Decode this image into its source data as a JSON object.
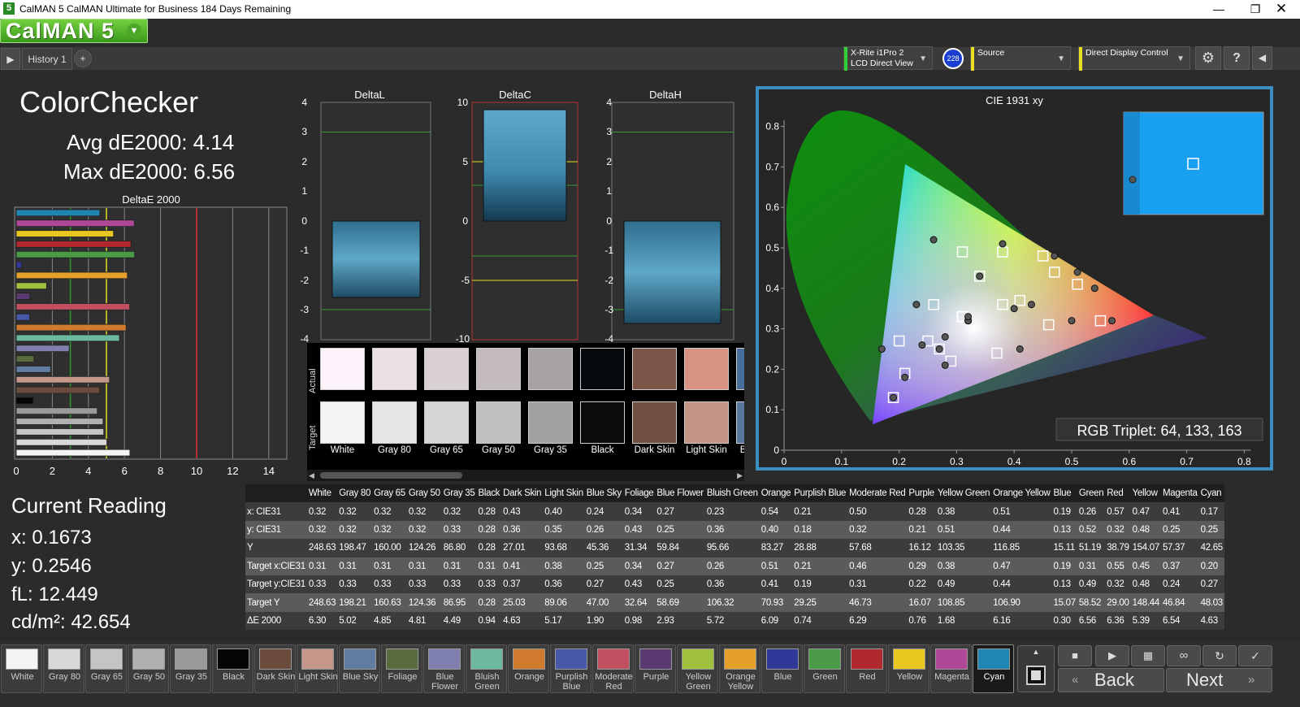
{
  "window": {
    "title": "CalMAN 5 CalMAN Ultimate for Business 184 Days Remaining",
    "app_icon": "5"
  },
  "logo": {
    "text": "CalMAN 5"
  },
  "tabs": {
    "history": "History 1"
  },
  "devices": {
    "meter_line1": "X-Rite i1Pro 2",
    "meter_line2": "LCD Direct View",
    "meter_badge": "228",
    "source": "Source",
    "display": "Direct Display Control"
  },
  "page": {
    "title": "ColorChecker",
    "avg": "Avg dE2000: 4.14",
    "max": "Max dE2000: 6.56"
  },
  "deltae_chart": {
    "title": "DeltaE 2000",
    "x_ticks": [
      "0",
      "2",
      "4",
      "6",
      "8",
      "10",
      "12",
      "14"
    ]
  },
  "delta_charts": {
    "l_title": "DeltaL",
    "c_title": "DeltaC",
    "h_title": "DeltaH",
    "l_ticks": [
      "4",
      "3",
      "2",
      "1",
      "0",
      "-1",
      "-2",
      "-3",
      "-4"
    ],
    "c_ticks": [
      "10",
      "5",
      "0",
      "-5",
      "-10"
    ],
    "h_ticks": [
      "4",
      "3",
      "2",
      "1",
      "0",
      "-1",
      "-2",
      "-3",
      "-4"
    ]
  },
  "patch_strip": {
    "actual_label": "Actual",
    "target_label": "Target"
  },
  "cie": {
    "title": "CIE 1931 xy",
    "x_ticks": [
      "0",
      "0.1",
      "0.2",
      "0.3",
      "0.4",
      "0.5",
      "0.6",
      "0.7",
      "0.8"
    ],
    "y_ticks": [
      "0.8",
      "0.7",
      "0.6",
      "0.5",
      "0.4",
      "0.3",
      "0.2",
      "0.1",
      "0"
    ],
    "rgb": "RGB Triplet: 64, 133, 163"
  },
  "reading": {
    "title": "Current Reading",
    "x": "x: 0.1673",
    "y": "y: 0.2546",
    "fl": "fL: 12.449",
    "cdm2": "cd/m²: 42.654"
  },
  "table": {
    "headers": [
      "",
      "White",
      "Gray 80",
      "Gray 65",
      "Gray 50",
      "Gray 35",
      "Black",
      "Dark Skin",
      "Light Skin",
      "Blue Sky",
      "Foliage",
      "Blue Flower",
      "Bluish Green",
      "Orange",
      "Purplish Blue",
      "Moderate Red",
      "Purple",
      "Yellow Green",
      "Orange Yellow",
      "Blue",
      "Green",
      "Red",
      "Yellow",
      "Magenta",
      "Cyan"
    ],
    "rows": [
      [
        "x: CIE31",
        "0.32",
        "0.32",
        "0.32",
        "0.32",
        "0.32",
        "0.28",
        "0.43",
        "0.40",
        "0.24",
        "0.34",
        "0.27",
        "0.23",
        "0.54",
        "0.21",
        "0.50",
        "0.28",
        "0.38",
        "0.51",
        "0.19",
        "0.26",
        "0.57",
        "0.47",
        "0.41",
        "0.17"
      ],
      [
        "y: CIE31",
        "0.32",
        "0.32",
        "0.32",
        "0.32",
        "0.33",
        "0.28",
        "0.36",
        "0.35",
        "0.26",
        "0.43",
        "0.25",
        "0.36",
        "0.40",
        "0.18",
        "0.32",
        "0.21",
        "0.51",
        "0.44",
        "0.13",
        "0.52",
        "0.32",
        "0.48",
        "0.25",
        "0.25"
      ],
      [
        "Y",
        "248.63",
        "198.47",
        "160.00",
        "124.26",
        "86.80",
        "0.28",
        "27.01",
        "93.68",
        "45.36",
        "31.34",
        "59.84",
        "95.66",
        "83.27",
        "28.88",
        "57.68",
        "16.12",
        "103.35",
        "116.85",
        "15.11",
        "51.19",
        "38.79",
        "154.07",
        "57.37",
        "42.65"
      ],
      [
        "Target x:CIE31",
        "0.31",
        "0.31",
        "0.31",
        "0.31",
        "0.31",
        "0.31",
        "0.41",
        "0.38",
        "0.25",
        "0.34",
        "0.27",
        "0.26",
        "0.51",
        "0.21",
        "0.46",
        "0.29",
        "0.38",
        "0.47",
        "0.19",
        "0.31",
        "0.55",
        "0.45",
        "0.37",
        "0.20"
      ],
      [
        "Target y:CIE31",
        "0.33",
        "0.33",
        "0.33",
        "0.33",
        "0.33",
        "0.33",
        "0.37",
        "0.36",
        "0.27",
        "0.43",
        "0.25",
        "0.36",
        "0.41",
        "0.19",
        "0.31",
        "0.22",
        "0.49",
        "0.44",
        "0.13",
        "0.49",
        "0.32",
        "0.48",
        "0.24",
        "0.27"
      ],
      [
        "Target Y",
        "248.63",
        "198.21",
        "160.63",
        "124.36",
        "86.95",
        "0.28",
        "25.03",
        "89.06",
        "47.00",
        "32.64",
        "58.69",
        "106.32",
        "70.93",
        "29.25",
        "46.73",
        "16.07",
        "108.85",
        "106.90",
        "15.07",
        "58.52",
        "29.00",
        "148.44",
        "46.84",
        "48.03"
      ],
      [
        "ΔE 2000",
        "6.30",
        "5.02",
        "4.85",
        "4.81",
        "4.49",
        "0.94",
        "4.63",
        "5.17",
        "1.90",
        "0.98",
        "2.93",
        "5.72",
        "6.09",
        "0.74",
        "6.29",
        "0.76",
        "1.68",
        "6.16",
        "0.30",
        "6.56",
        "6.36",
        "5.39",
        "6.54",
        "4.63"
      ]
    ]
  },
  "swatches": [
    {
      "label": "White",
      "color": "#f4f4f4"
    },
    {
      "label": "Gray 80",
      "color": "#d8d8d8"
    },
    {
      "label": "Gray 65",
      "color": "#c4c4c4"
    },
    {
      "label": "Gray 50",
      "color": "#b0b0b0"
    },
    {
      "label": "Gray 35",
      "color": "#9a9a9a"
    },
    {
      "label": "Black",
      "color": "#050505"
    },
    {
      "label": "Dark Skin",
      "color": "#6b4b3c"
    },
    {
      "label": "Light Skin",
      "color": "#c4978a"
    },
    {
      "label": "Blue Sky",
      "color": "#607ca0"
    },
    {
      "label": "Foliage",
      "color": "#5a6b3e"
    },
    {
      "label": "Blue Flower",
      "color": "#8080b0"
    },
    {
      "label": "Bluish Green",
      "color": "#6cb8a0"
    },
    {
      "label": "Orange",
      "color": "#d07a2e"
    },
    {
      "label": "Purplish Blue",
      "color": "#4858a8"
    },
    {
      "label": "Moderate Red",
      "color": "#c05060"
    },
    {
      "label": "Purple",
      "color": "#5a3a70"
    },
    {
      "label": "Yellow Green",
      "color": "#a0c040"
    },
    {
      "label": "Orange Yellow",
      "color": "#e4a02a"
    },
    {
      "label": "Blue",
      "color": "#303898"
    },
    {
      "label": "Green",
      "color": "#4a9a48"
    },
    {
      "label": "Red",
      "color": "#b0282c"
    },
    {
      "label": "Yellow",
      "color": "#e8c820"
    },
    {
      "label": "Magenta",
      "color": "#b04898"
    },
    {
      "label": "Cyan",
      "color": "#1e86b0"
    }
  ],
  "nav": {
    "back": "Back",
    "next": "Next"
  }
}
